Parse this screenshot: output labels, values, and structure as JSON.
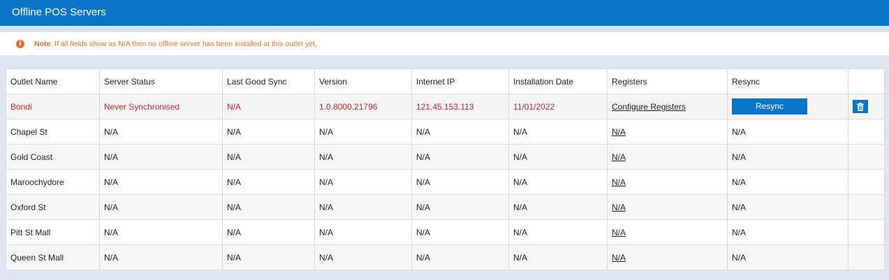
{
  "header": {
    "title": "Offline POS Servers"
  },
  "note": {
    "icon": "info-icon",
    "label": "Note",
    "text": ": If all fields show as N/A then no offline server has been installed at this outlet yet."
  },
  "table": {
    "columns": [
      "Outlet Name",
      "Server Status",
      "Last Good Sync",
      "Version",
      "Internet IP",
      "Installation Date",
      "Registers",
      "Resync",
      ""
    ],
    "rows": [
      {
        "outlet": "Bondi",
        "status": "Never Synchronised",
        "last_sync": "N/A",
        "version": "1.0.8000.21796",
        "ip": "121.45.153.113",
        "install_date": "11/01/2022",
        "registers": "Configure Registers",
        "resync": "Resync"
      },
      {
        "outlet": "Chapel St",
        "status": "N/A",
        "last_sync": "N/A",
        "version": "N/A",
        "ip": "N/A",
        "install_date": "N/A",
        "registers": "N/A",
        "resync": "N/A"
      },
      {
        "outlet": "Gold Coast",
        "status": "N/A",
        "last_sync": "N/A",
        "version": "N/A",
        "ip": "N/A",
        "install_date": "N/A",
        "registers": "N/A",
        "resync": "N/A"
      },
      {
        "outlet": "Maroochydore",
        "status": "N/A",
        "last_sync": "N/A",
        "version": "N/A",
        "ip": "N/A",
        "install_date": "N/A",
        "registers": "N/A",
        "resync": "N/A"
      },
      {
        "outlet": "Oxford St",
        "status": "N/A",
        "last_sync": "N/A",
        "version": "N/A",
        "ip": "N/A",
        "install_date": "N/A",
        "registers": "N/A",
        "resync": "N/A"
      },
      {
        "outlet": "Pitt St Mall",
        "status": "N/A",
        "last_sync": "N/A",
        "version": "N/A",
        "ip": "N/A",
        "install_date": "N/A",
        "registers": "N/A",
        "resync": "N/A"
      },
      {
        "outlet": "Queen St Mall",
        "status": "N/A",
        "last_sync": "N/A",
        "version": "N/A",
        "ip": "N/A",
        "install_date": "N/A",
        "registers": "N/A",
        "resync": "N/A"
      }
    ]
  },
  "colors": {
    "brand_blue": "#0a74c9",
    "note_orange": "#e8702a",
    "highlight_red": "#c8243c"
  },
  "icons": {
    "delete": "trash-icon"
  }
}
